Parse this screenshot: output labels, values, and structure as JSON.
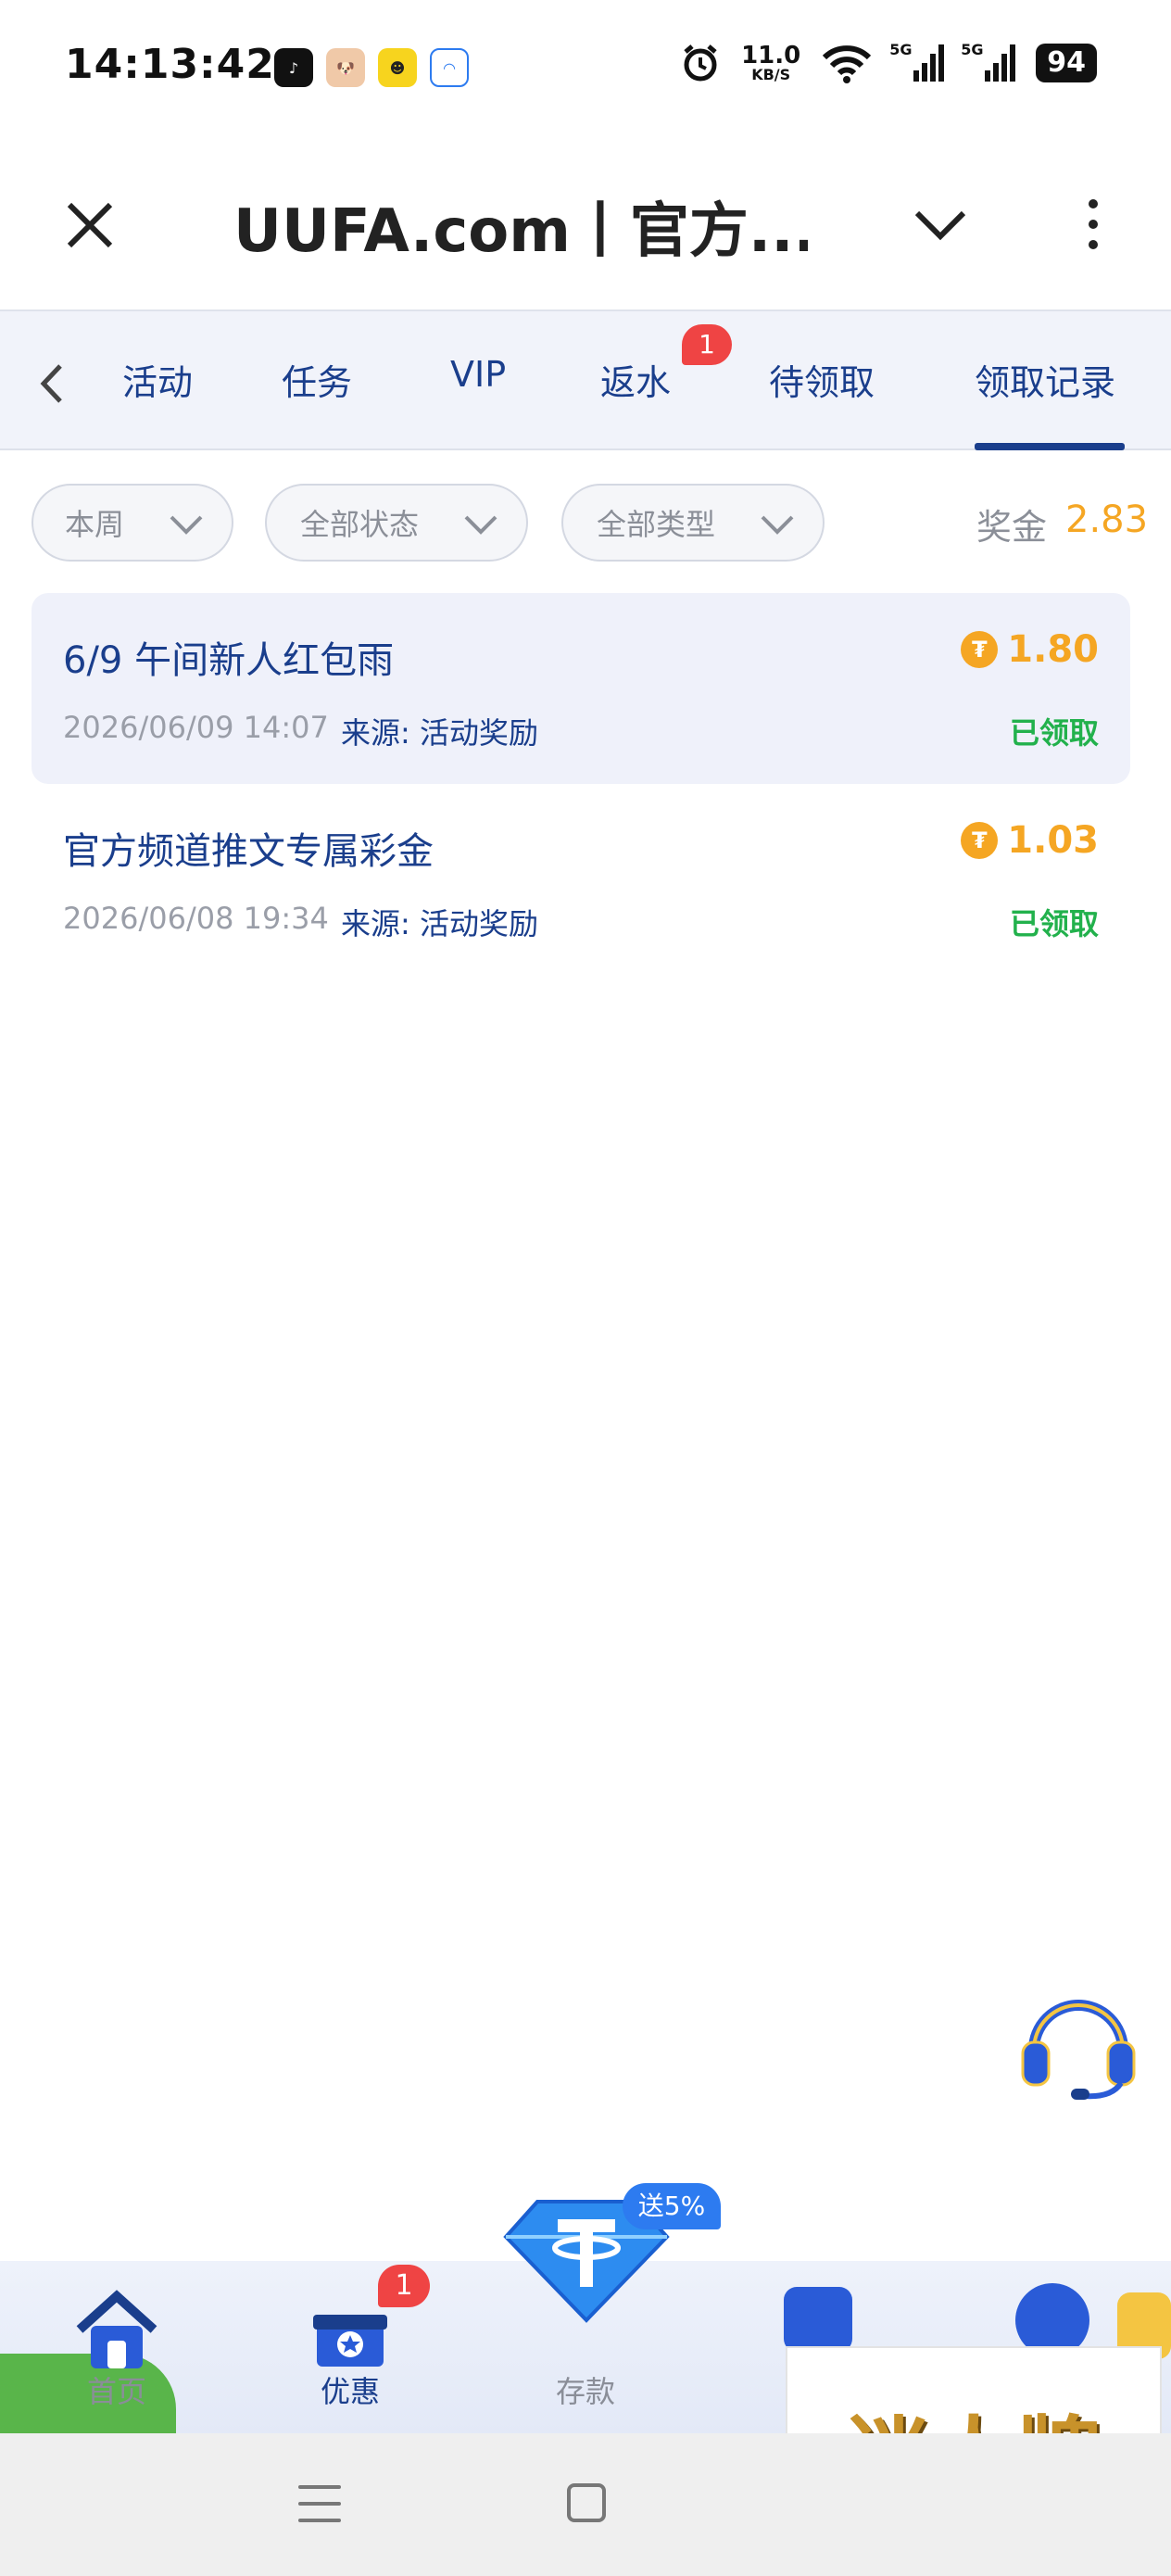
{
  "status_bar": {
    "time": "14:13:42",
    "net_speed_value": "11.0",
    "net_speed_unit": "KB/S",
    "signal_1_label": "5G",
    "signal_2_label": "5G",
    "battery": "94"
  },
  "header": {
    "title": "UUFA.com丨官方..."
  },
  "tabs": {
    "items": [
      {
        "label": "活动"
      },
      {
        "label": "任务"
      },
      {
        "label": "VIP"
      },
      {
        "label": "返水"
      },
      {
        "label": "待领取"
      },
      {
        "label": "领取记录"
      }
    ],
    "active_index": 5,
    "rebate_badge": "1"
  },
  "filters": {
    "period": "本周",
    "status": "全部状态",
    "type": "全部类型",
    "bonus_label": "奖金",
    "bonus_value": "2.83"
  },
  "records": [
    {
      "title": "6/9 午间新人红包雨",
      "amount": "1.80",
      "date": "2026/06/09 14:07",
      "source": "来源: 活动奖励",
      "status": "已领取"
    },
    {
      "title": "官方频道推文专属彩金",
      "amount": "1.03",
      "date": "2026/06/08 19:34",
      "source": "来源: 活动奖励",
      "status": "已领取"
    }
  ],
  "bottom_nav": {
    "home": "首页",
    "promos": "优惠",
    "promos_badge": "1",
    "deposit": "存款",
    "deposit_badge": "送5%"
  },
  "watermark": "迷人牌",
  "colors": {
    "primary": "#1a3e8c",
    "gold": "#f5a623",
    "success": "#22b14c",
    "badge": "#ef4444"
  }
}
